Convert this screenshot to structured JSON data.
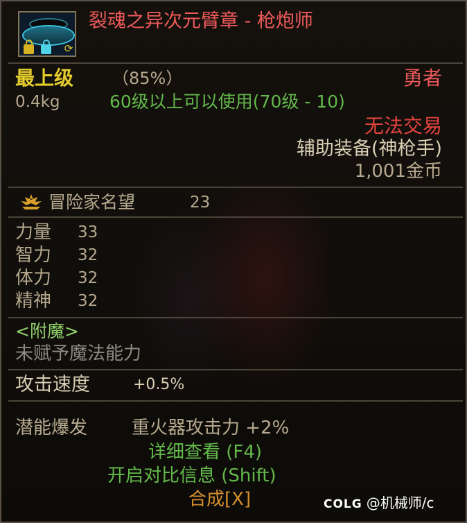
{
  "item": {
    "name": "裂魂之异次元臂章 - 枪炮师",
    "rarity": "最上级",
    "quality": "（85%）",
    "weight": "0.4kg",
    "required_level": "60级以上可以使用(70级 - 10)",
    "grade": "勇者",
    "trade_status": "无法交易",
    "type": "辅助装备(神枪手)",
    "price": "1,001金币"
  },
  "fame": {
    "label": "冒险家名望",
    "value": "23"
  },
  "stats": [
    {
      "label": "力量",
      "value": "33"
    },
    {
      "label": "智力",
      "value": "32"
    },
    {
      "label": "体力",
      "value": "32"
    },
    {
      "label": "精神",
      "value": "32"
    }
  ],
  "enchant": {
    "header": "<附魔>",
    "status": "未赋予魔法能力"
  },
  "attack_speed": {
    "label": "攻击速度",
    "value": "+0.5%"
  },
  "potential": {
    "label": "潜能爆发",
    "effect": "重火器攻击力 +2%"
  },
  "actions": {
    "details": "详细查看 (F4)",
    "compare": "开启对比信息 (Shift)",
    "synthesize": "合成[X]"
  },
  "watermark": {
    "logo": "COLG",
    "handle": "@机械师/c"
  },
  "icons": [
    "lock-icon",
    "swap-icon",
    "fame-emblem-icon"
  ],
  "colors": {
    "rarity": "#e4cc2c",
    "title": "#ee5a5a",
    "usable": "#63b94a",
    "untradable": "#e5433d",
    "synthesize": "#d68f2f"
  }
}
